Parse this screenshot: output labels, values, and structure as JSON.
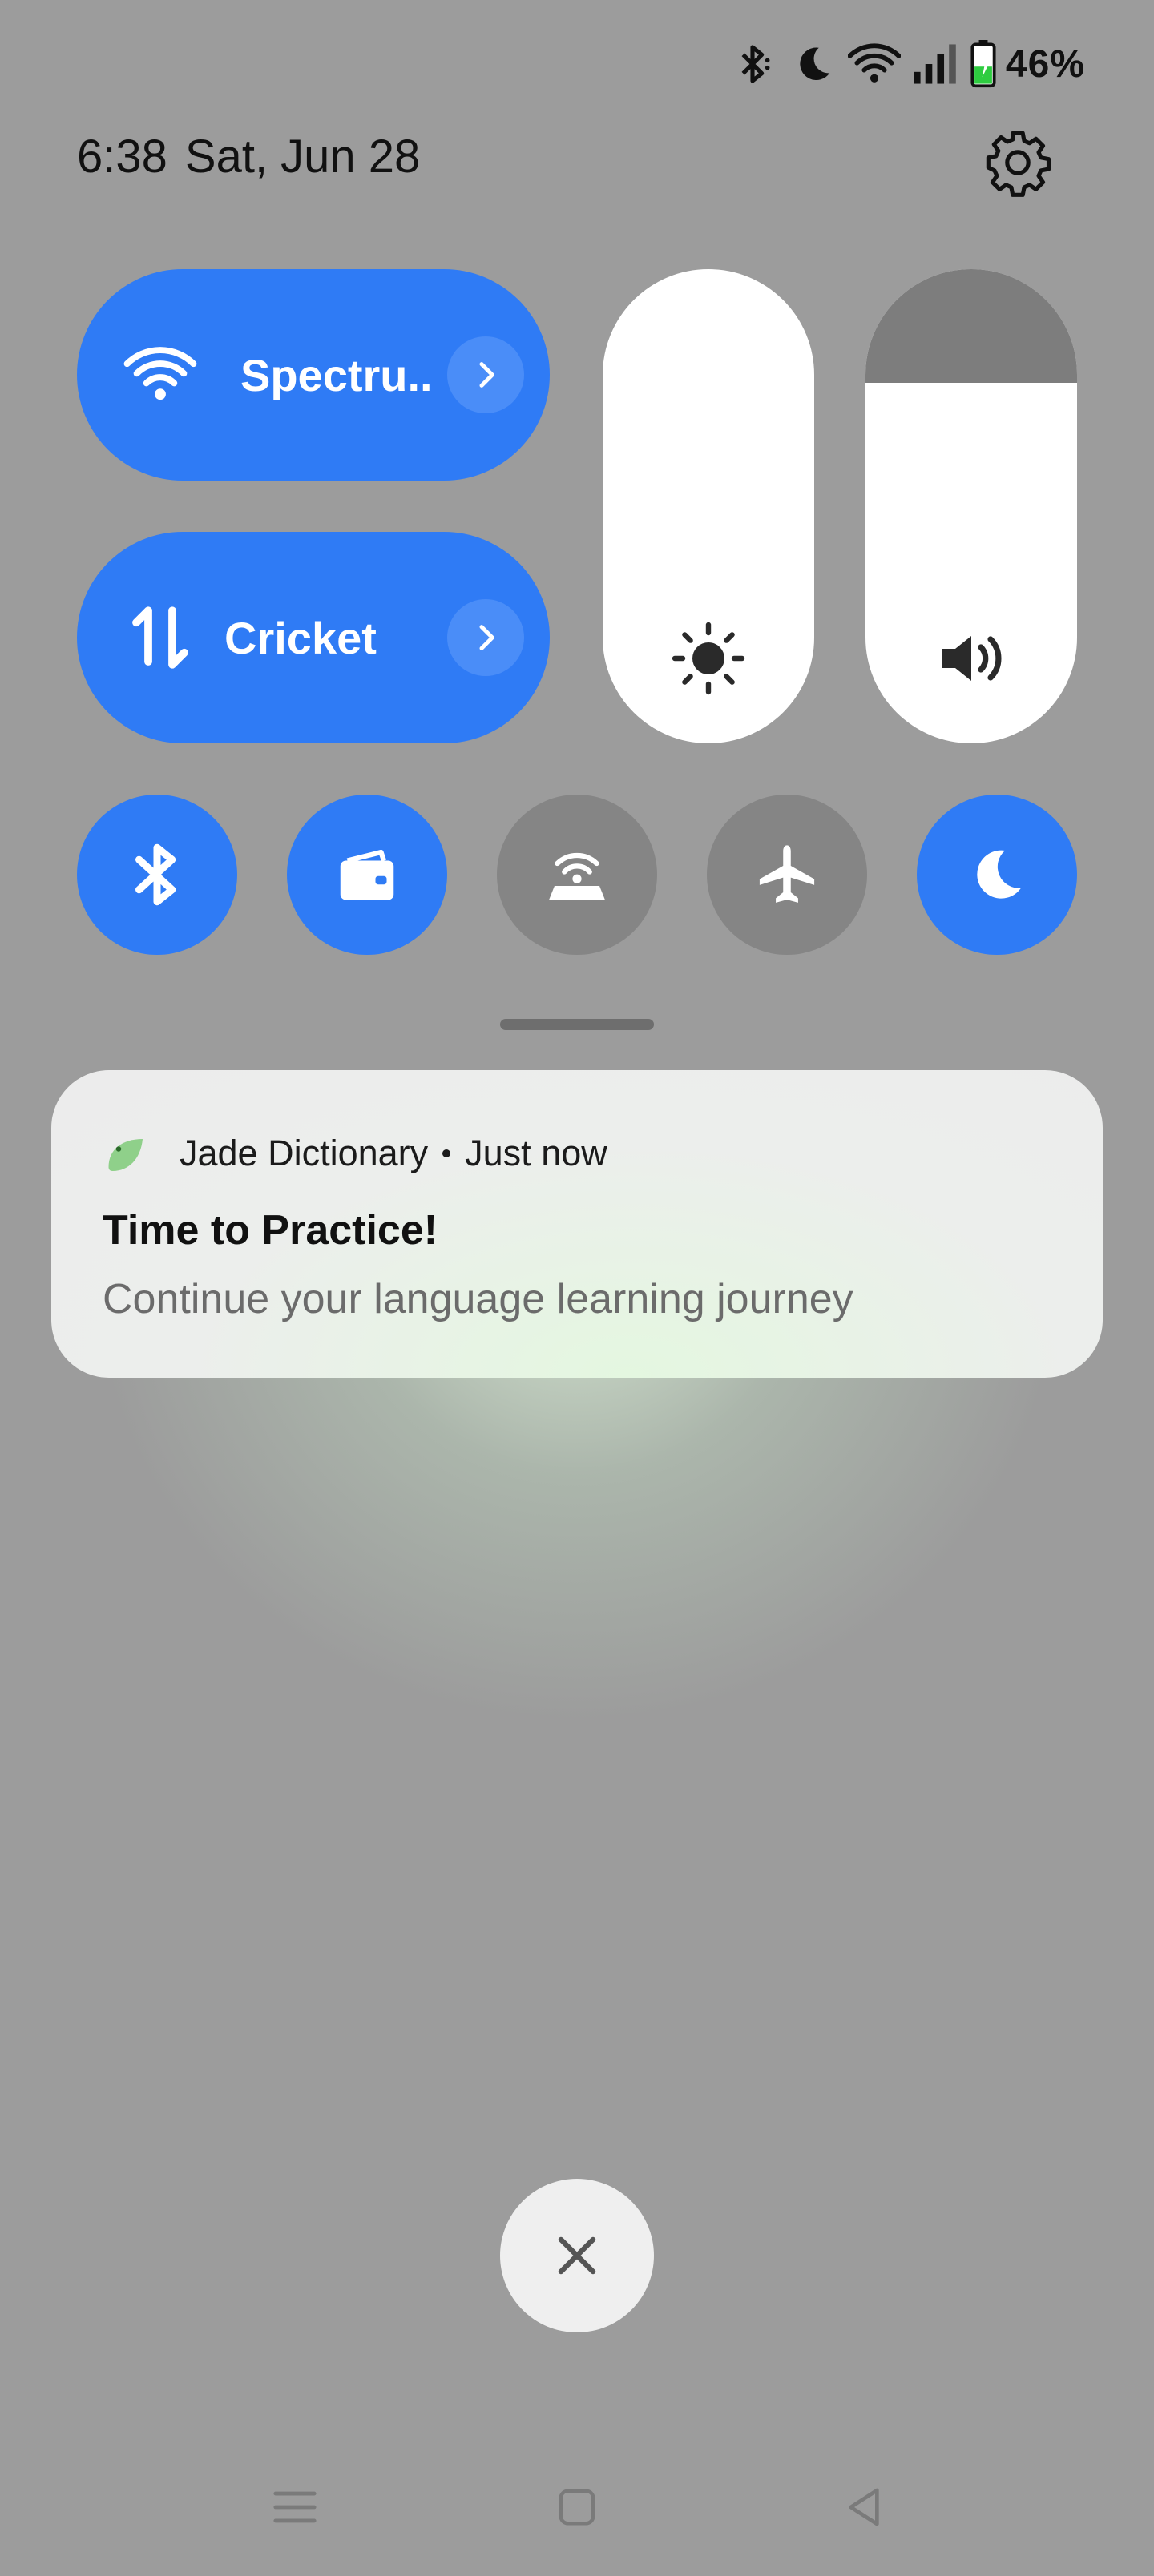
{
  "status_bar": {
    "icons": [
      "bluetooth-icon",
      "moon-icon",
      "wifi-icon",
      "signal-icon",
      "battery-charging-icon"
    ],
    "battery_percent": "46%",
    "battery_level": 0.46,
    "battery_color": "#2ecc40"
  },
  "header": {
    "time": "6:38",
    "date": "Sat, Jun 28",
    "settings_icon": "gear-icon"
  },
  "quick_settings": {
    "accent": "#2f7bf5",
    "wifi_tile": {
      "label": "Spectru..",
      "icon": "wifi-icon",
      "chevron": "chevron-right-icon"
    },
    "data_tile": {
      "label": "Cricket",
      "icon": "mobile-data-icon",
      "chevron": "chevron-right-icon"
    },
    "brightness": {
      "icon": "brightness-icon",
      "level": 1.0
    },
    "volume": {
      "icon": "volume-icon",
      "level": 0.76
    },
    "toggles": [
      {
        "name": "bluetooth",
        "icon": "bluetooth-icon",
        "state": "on"
      },
      {
        "name": "wallet",
        "icon": "wallet-icon",
        "state": "on"
      },
      {
        "name": "hotspot",
        "icon": "hotspot-icon",
        "state": "off"
      },
      {
        "name": "airplane-mode",
        "icon": "airplane-icon",
        "state": "off"
      },
      {
        "name": "do-not-disturb",
        "icon": "moon-icon",
        "state": "on"
      }
    ]
  },
  "notification": {
    "app_name": "Jade Dictionary",
    "time": "Just now",
    "title": "Time to Practice!",
    "body": "Continue your language learning journey",
    "app_icon": "jade-leaf-icon"
  },
  "clear_button": {
    "icon": "close-icon"
  },
  "navigation": {
    "icons": [
      "menu-icon",
      "home-icon",
      "back-icon"
    ]
  }
}
